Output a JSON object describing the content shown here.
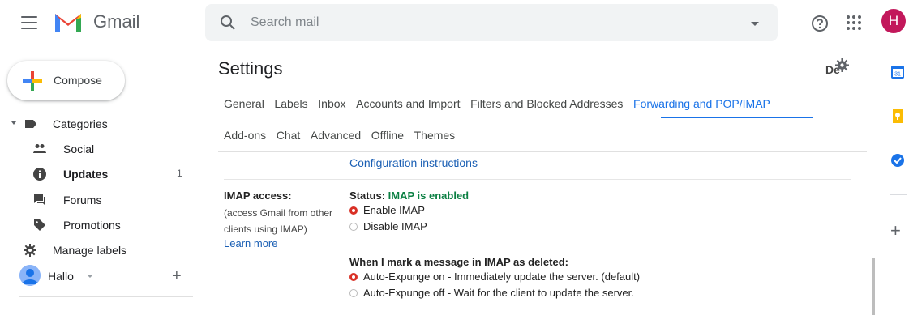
{
  "header": {
    "app_name": "Gmail",
    "search_placeholder": "Search mail",
    "avatar_initial": "H"
  },
  "sidebar": {
    "compose_label": "Compose",
    "items": [
      {
        "label": "Categories",
        "icon": "label-icon"
      },
      {
        "label": "Social",
        "icon": "people-icon"
      },
      {
        "label": "Updates",
        "icon": "info-icon",
        "count": "1",
        "bold": true
      },
      {
        "label": "Forums",
        "icon": "forum-icon"
      },
      {
        "label": "Promotions",
        "icon": "tag-icon"
      },
      {
        "label": "Manage labels",
        "icon": "gear-icon"
      }
    ],
    "account_label": "Hallo"
  },
  "settings": {
    "title": "Settings",
    "density_label": "De",
    "tabs_row1": [
      "General",
      "Labels",
      "Inbox",
      "Accounts and Import",
      "Filters and Blocked Addresses",
      "Forwarding and POP/IMAP"
    ],
    "tabs_row2": [
      "Add-ons",
      "Chat",
      "Advanced",
      "Offline",
      "Themes"
    ],
    "active_tab": "Forwarding and POP/IMAP",
    "config_link": "Configuration instructions",
    "imap": {
      "label": "IMAP access:",
      "sublabel": "(access Gmail from other clients using IMAP)",
      "learn_more": "Learn more",
      "status_prefix": "Status: ",
      "status_value": "IMAP is enabled",
      "options": [
        {
          "label": "Enable IMAP",
          "checked": true
        },
        {
          "label": "Disable IMAP",
          "checked": false
        }
      ]
    },
    "deleted": {
      "label": "When I mark a message in IMAP as deleted:",
      "options": [
        {
          "label": "Auto-Expunge on - Immediately update the server. (default)",
          "checked": true
        },
        {
          "label": "Auto-Expunge off - Wait for the client to update the server.",
          "checked": false
        }
      ]
    }
  },
  "colors": {
    "accent": "#1a73e8",
    "status_on": "#0b8043",
    "radio_checked": "#d93025",
    "avatar": "#c2185b"
  }
}
